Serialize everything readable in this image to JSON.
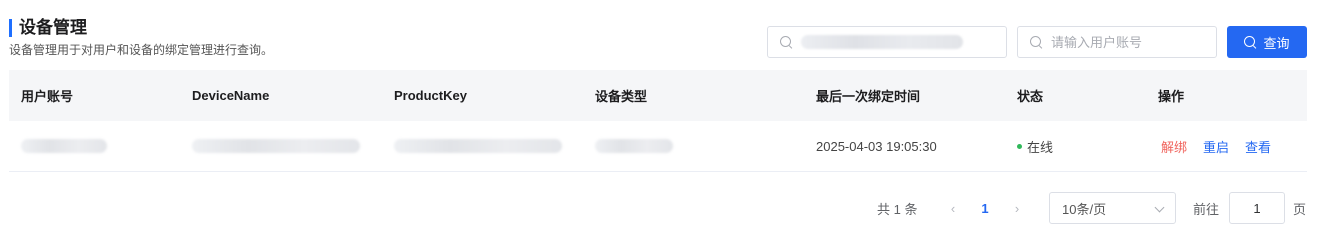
{
  "header": {
    "title": "设备管理",
    "subtitle": "设备管理用于对用户和设备的绑定管理进行查询。"
  },
  "search": {
    "device_value": "",
    "user_placeholder": "请输入用户账号",
    "query_label": "查询"
  },
  "table": {
    "columns": [
      "用户账号",
      "DeviceName",
      "ProductKey",
      "设备类型",
      "最后一次绑定时间",
      "状态",
      "操作"
    ],
    "rows": [
      {
        "user_account": "",
        "device_name": "",
        "product_key": "",
        "device_type": "",
        "last_bind_time": "2025-04-03 19:05:30",
        "status": "在线",
        "actions": [
          "解绑",
          "重启",
          "查看"
        ]
      }
    ]
  },
  "pagination": {
    "total": "共 1 条",
    "prev": "‹",
    "current_page": "1",
    "next": "›",
    "page_size": "10条/页",
    "goto_label": "前往",
    "goto_value": "1",
    "goto_suffix": "页"
  },
  "colors": {
    "accent": "#2468f2",
    "danger": "#f0635c",
    "online": "#30b85a"
  },
  "icons": [
    "search-icon",
    "chevron-left-icon",
    "chevron-right-icon",
    "chevron-down-icon"
  ]
}
